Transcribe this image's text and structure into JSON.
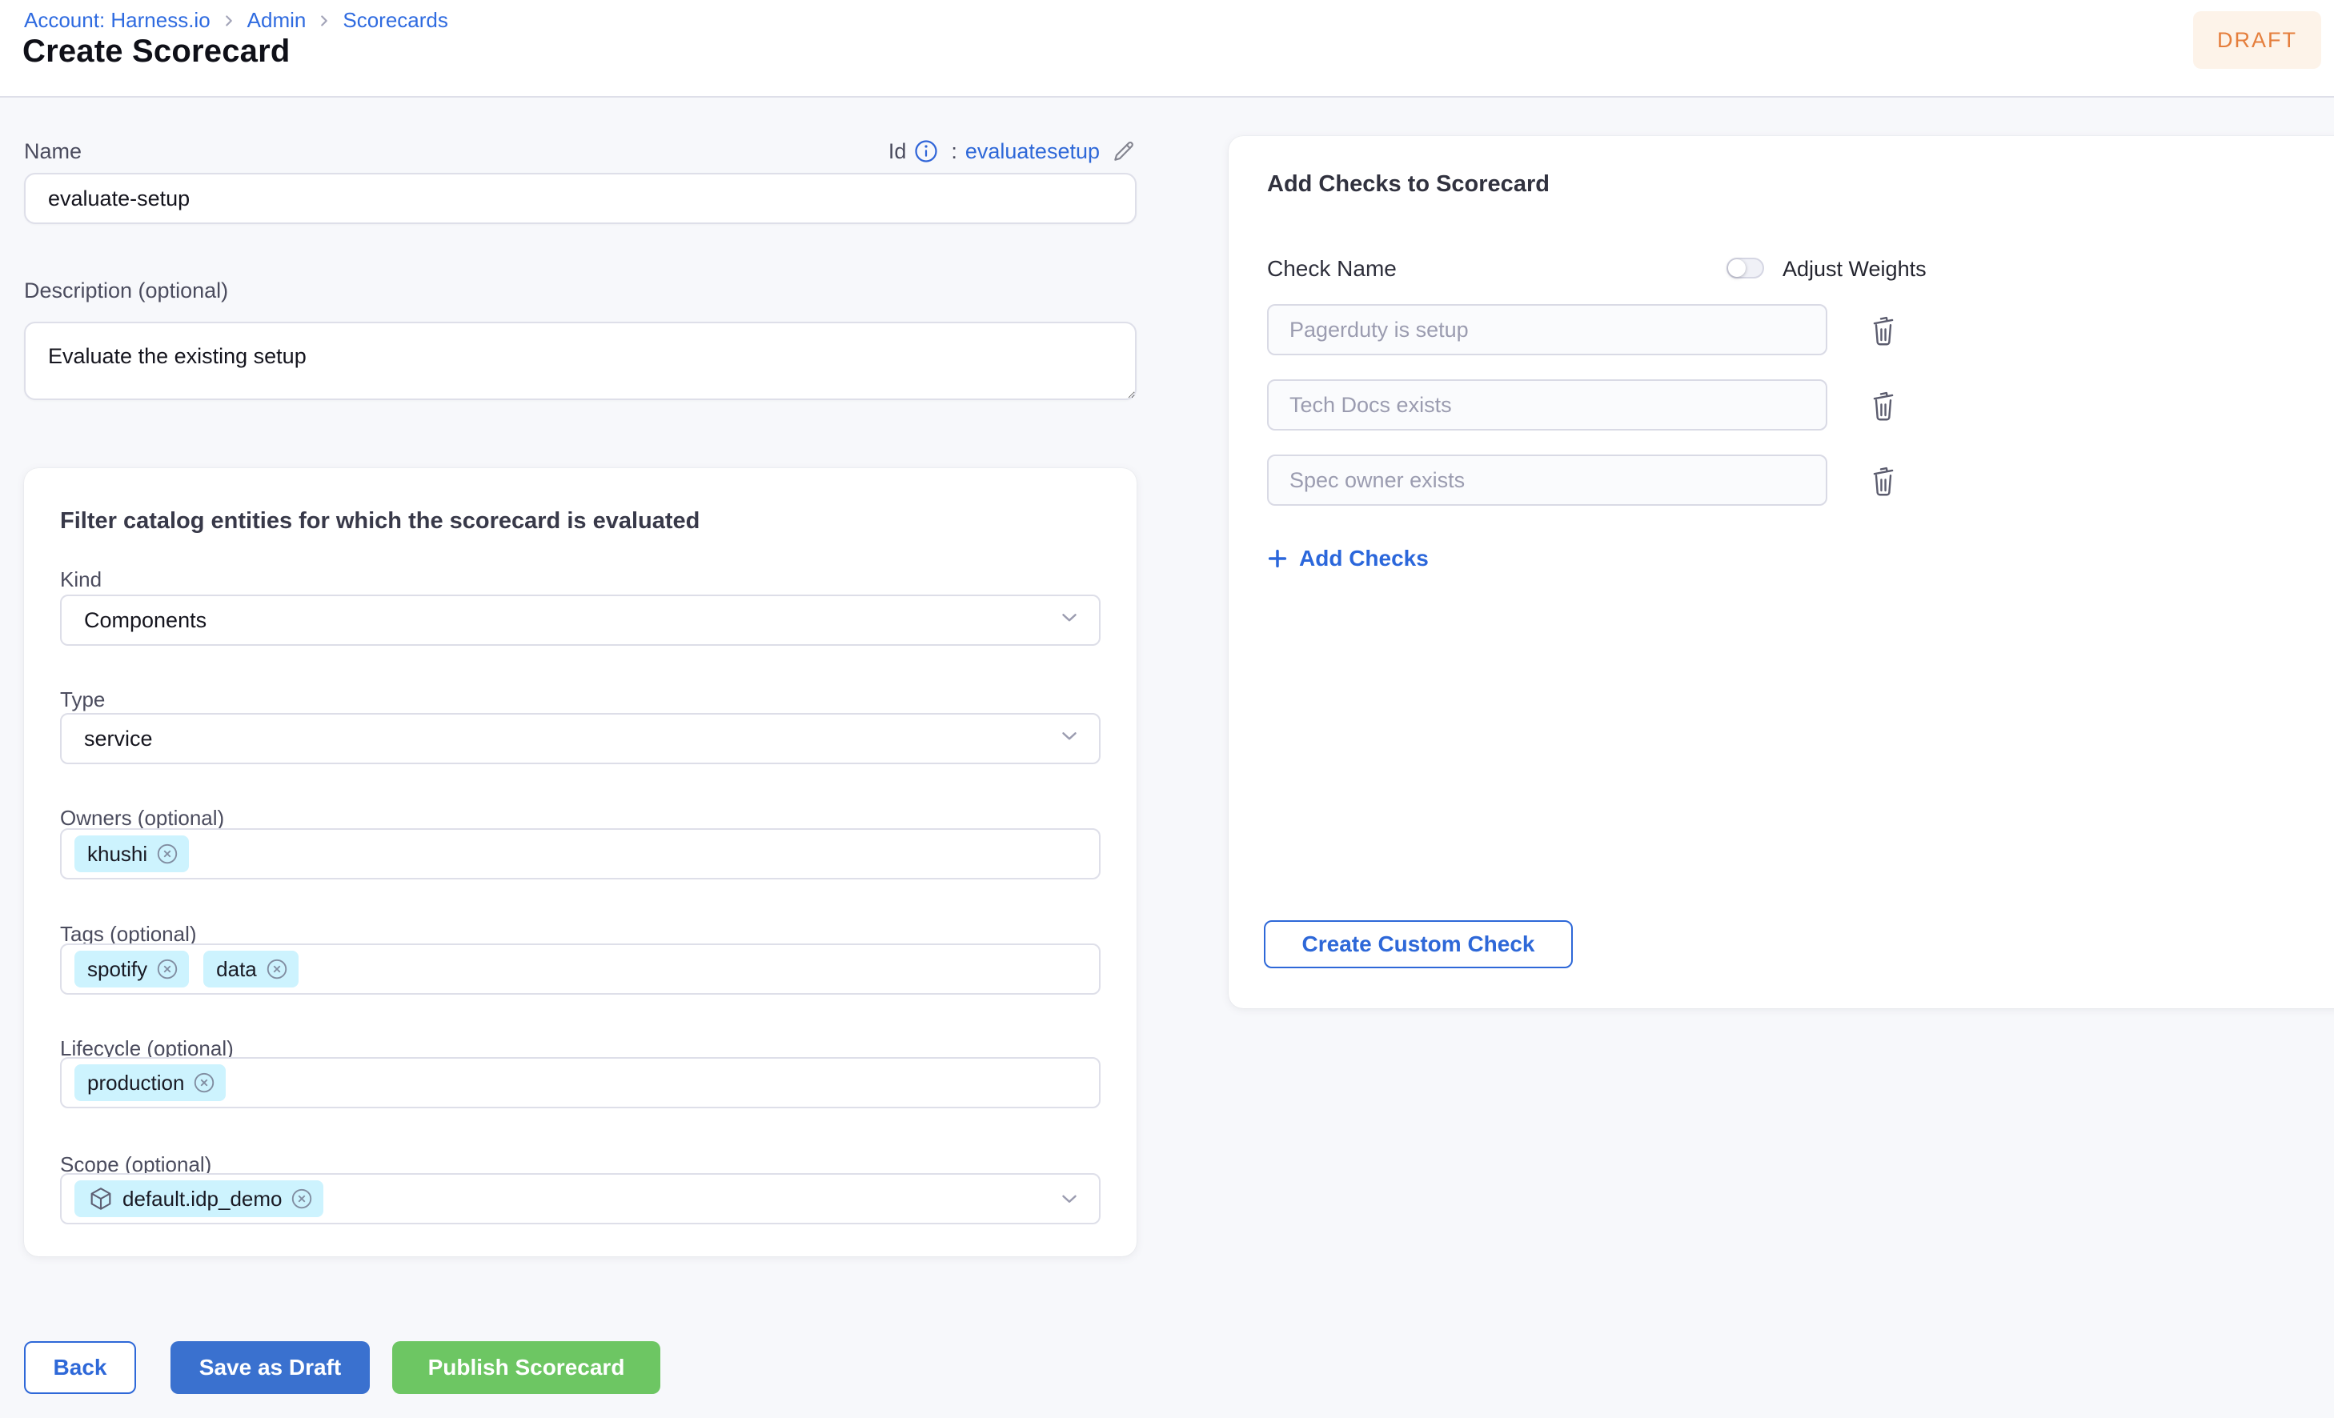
{
  "breadcrumb": {
    "account": "Account: Harness.io",
    "admin": "Admin",
    "scorecards": "Scorecards"
  },
  "header": {
    "title": "Create Scorecard",
    "status_badge": "DRAFT"
  },
  "name_field": {
    "label": "Name",
    "value": "evaluate-setup"
  },
  "id_field": {
    "label": "Id",
    "colon": ":",
    "value": "evaluatesetup"
  },
  "description_field": {
    "label": "Description (optional)",
    "value": "Evaluate the existing setup"
  },
  "filter_section": {
    "title": "Filter catalog entities for which the scorecard is evaluated",
    "kind": {
      "label": "Kind",
      "value": "Components"
    },
    "type": {
      "label": "Type",
      "value": "service"
    },
    "owners": {
      "label": "Owners (optional)",
      "chips": [
        "khushi"
      ]
    },
    "tags": {
      "label": "Tags (optional)",
      "chips": [
        "spotify",
        "data"
      ]
    },
    "lifecycle": {
      "label": "Lifecycle (optional)",
      "chips": [
        "production"
      ]
    },
    "scope": {
      "label": "Scope (optional)",
      "chips": [
        "default.idp_demo"
      ]
    }
  },
  "footer_actions": {
    "back": "Back",
    "save_as_draft": "Save as Draft",
    "publish": "Publish Scorecard"
  },
  "checks_panel": {
    "title": "Add Checks to Scorecard",
    "check_name_label": "Check Name",
    "adjust_weights": {
      "label": "Adjust Weights",
      "enabled": false
    },
    "checks": [
      "Pagerduty is setup",
      "Tech Docs exists",
      "Spec owner exists"
    ],
    "add_checks": "Add Checks",
    "create_custom_check": "Create Custom Check"
  },
  "colors": {
    "primary_blue": "#2E68D8",
    "button_blue": "#3A71CF",
    "success_green": "#6DC663",
    "chip_blue": "#CDF3FE",
    "draft_bg": "#FDF3E9",
    "draft_text": "#E57E3C",
    "page_bg": "#F7F8FB"
  },
  "icons": {
    "info": "circled-i",
    "edit": "pencil",
    "chevron_down": "v",
    "chevron_right": ">",
    "remove": "circled-x",
    "cube": "box",
    "trash": "trash-can",
    "plus": "+"
  }
}
